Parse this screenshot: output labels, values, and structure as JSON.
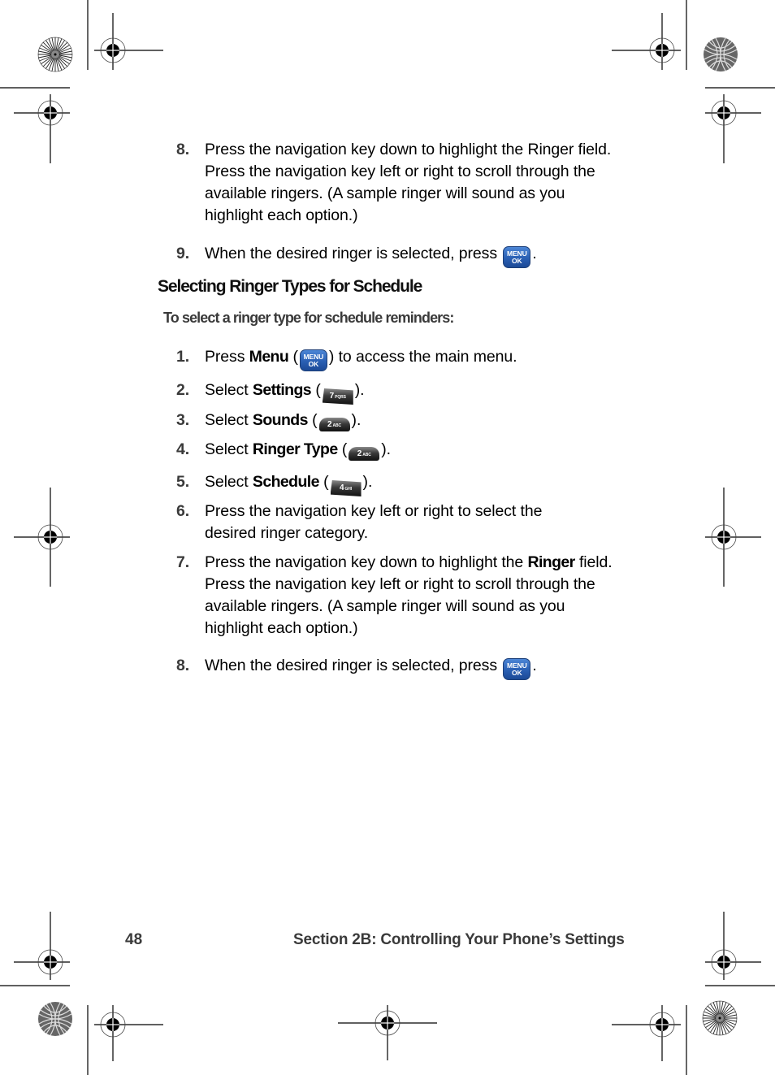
{
  "steps_top": [
    {
      "num": "8.",
      "text": "Press the navigation key down to highlight the Ringer field. Press the navigation key left or right to scroll through the available ringers. (A sample ringer will sound as you highlight each option.)"
    },
    {
      "num": "9.",
      "text_before": "When the desired ringer is selected, press",
      "key": "menu-ok-key",
      "text_after": "."
    }
  ],
  "section": {
    "heading": "Selecting Ringer Types for Schedule",
    "subheading": "To select a ringer type for schedule reminders:",
    "steps": [
      {
        "num": "1.",
        "pre": "Press ",
        "bold": "Menu",
        "mid": " (",
        "key": "menu-ok-key",
        "post": ") to access the main menu."
      },
      {
        "num": "2.",
        "pre": "Select ",
        "bold": "Settings",
        "mid": " (",
        "key": "7-pqrs-key",
        "post": ")."
      },
      {
        "num": "3.",
        "pre": "Select ",
        "bold": "Sounds",
        "mid": " (",
        "key": "2-abc-key",
        "post": ")."
      },
      {
        "num": "4.",
        "pre": "Select ",
        "bold": "Ringer Type",
        "mid": " (",
        "key": "2-abc-key",
        "post": ")."
      },
      {
        "num": "5.",
        "pre": "Select ",
        "bold": "Schedule",
        "mid": " (",
        "key": "4-ghi-key",
        "post": ")."
      },
      {
        "num": "6.",
        "text": "Press the navigation key left or right to select the desired ringer category."
      },
      {
        "num": "7.",
        "pre": "Press the navigation key down to highlight the ",
        "bold": "Ringer",
        "post": " field. Press the navigation key left or right to scroll through the available ringers. (A sample ringer will sound as you highlight each option.)"
      },
      {
        "num": "8.",
        "text_before": "When the desired ringer is selected, press",
        "key": "menu-ok-key",
        "text_after": "."
      }
    ]
  },
  "keys": {
    "menu_line1": "MENU",
    "menu_line2": "OK",
    "key7_digit": "7",
    "key7_letters": "PQRS",
    "key2_digit": "2",
    "key2_letters": "ABC",
    "key4_digit": "4",
    "key4_letters": "GHI"
  },
  "footer": {
    "page_number": "48",
    "section_title": "Section 2B: Controlling Your Phone’s Settings"
  },
  "colors": {
    "text": "#000000",
    "step_number": "#3a3a3a",
    "menu_key": "#2a5fb3"
  }
}
